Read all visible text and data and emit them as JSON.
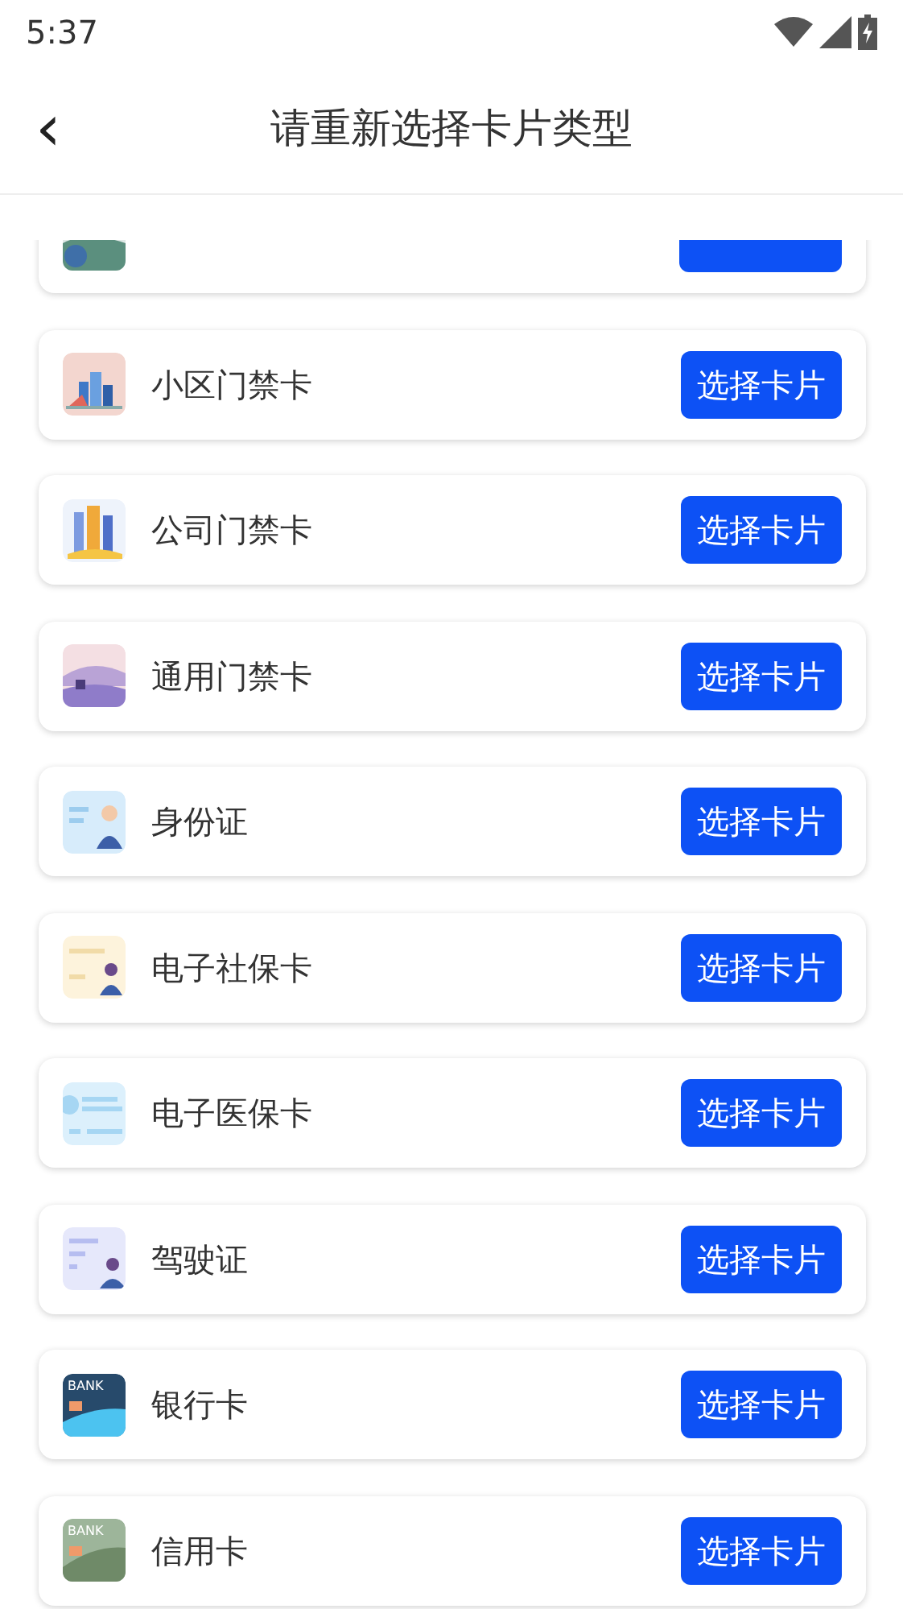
{
  "status_bar": {
    "time": "5:37"
  },
  "header": {
    "back": "‹",
    "title": "请重新选择卡片类型"
  },
  "cards": [
    {
      "kind": "lobby"
    },
    {
      "name": "小区门禁卡",
      "kind": "community",
      "button": "选择卡片"
    },
    {
      "name": "公司门禁卡",
      "kind": "office",
      "button": "选择卡片"
    },
    {
      "name": "通用门禁卡",
      "kind": "scenery",
      "button": "选择卡片"
    },
    {
      "name": "身份证",
      "kind": "id",
      "button": "选择卡片"
    },
    {
      "name": "电子社保卡",
      "kind": "social",
      "button": "选择卡片"
    },
    {
      "name": "电子医保卡",
      "kind": "medical",
      "button": "选择卡片"
    },
    {
      "name": "驾驶证",
      "kind": "license",
      "button": "选择卡片"
    },
    {
      "name": "银行卡",
      "kind": "bank",
      "brand": "BANK",
      "button": "选择卡片"
    },
    {
      "name": "信用卡",
      "kind": "credit",
      "brand": "BANK",
      "button": "选择卡片"
    }
  ]
}
